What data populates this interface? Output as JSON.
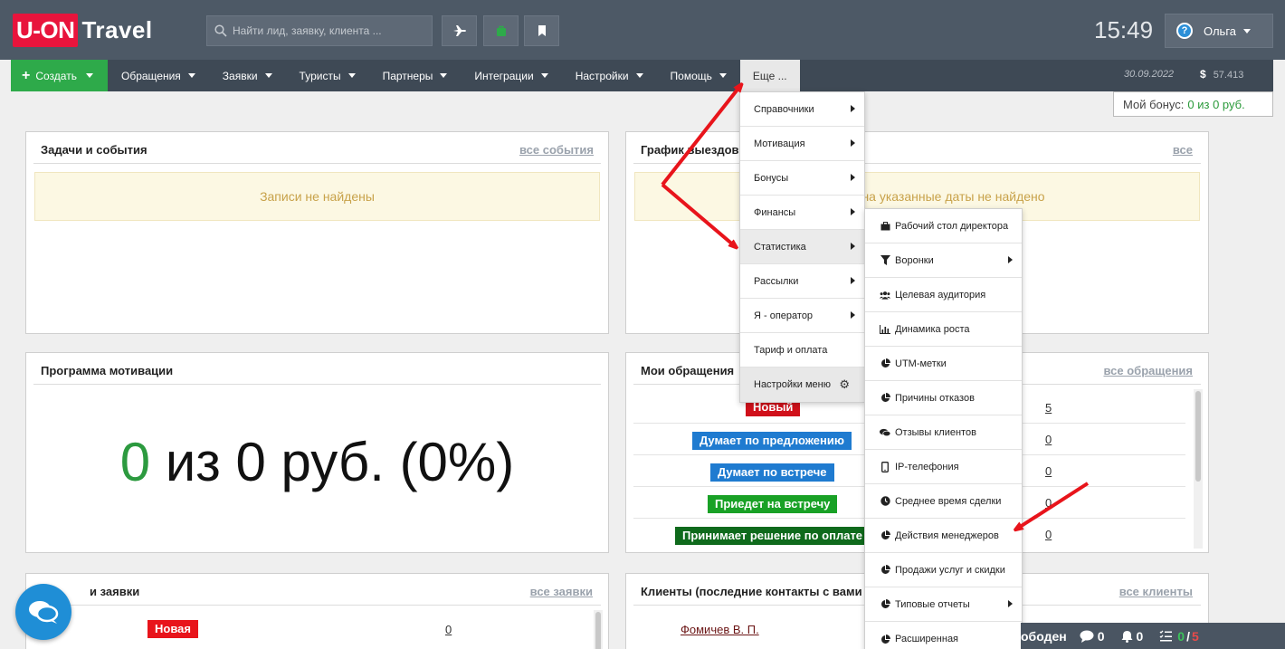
{
  "brand": {
    "logo_box": "U-ON",
    "logo_text": "Travel"
  },
  "search": {
    "placeholder": "Найти лид, заявку, клиента ..."
  },
  "header": {
    "clock": "15:49",
    "user_name": "Ольга"
  },
  "nav": {
    "create": "Создать",
    "items": [
      "Обращения",
      "Заявки",
      "Туристы",
      "Партнеры",
      "Интеграции",
      "Настройки",
      "Помощь"
    ],
    "more": "Еще ...",
    "date": "30.09.2022",
    "currency_symbol": "$",
    "balance": "57.413"
  },
  "bonus": {
    "label": "Мой бонус:",
    "value": "0 из 0 руб."
  },
  "panels": {
    "tasks": {
      "title": "Задачи и события",
      "link": "все события",
      "empty": "Записи не найдены"
    },
    "schedule": {
      "title": "График выездов",
      "link": "все",
      "empty": "на указанные даты не найдено"
    },
    "motivation": {
      "title": "Программа мотивации",
      "stat_zero": "0",
      "stat_rest": " из 0 руб. (0%)"
    },
    "appeals": {
      "title": "Мои обращения",
      "link": "все обращения",
      "rows": [
        {
          "status": "Новый",
          "count": "5",
          "color": "#d0101a"
        },
        {
          "status": "Думает по предложению",
          "count": "0",
          "color": "#1f7bd0"
        },
        {
          "status": "Думает по встрече",
          "count": "0",
          "color": "#1f7bd0"
        },
        {
          "status": "Приедет на встречу",
          "count": "0",
          "color": "#19a126"
        },
        {
          "status": "Принимает решение по оплате",
          "count": "0",
          "color": "#0f6a1c"
        }
      ]
    },
    "requests": {
      "title": "и заявки",
      "link": "все заявки",
      "row_status": "Новая",
      "row_count": "0"
    },
    "clients": {
      "title": "Клиенты (последние контакты с вами",
      "link": "все клиенты",
      "first_client": "Фомичев В. П."
    }
  },
  "menu_more": [
    {
      "label": "Справочники",
      "sub": true
    },
    {
      "label": "Мотивация",
      "sub": true
    },
    {
      "label": "Бонусы",
      "sub": true
    },
    {
      "label": "Финансы",
      "sub": true
    },
    {
      "label": "Статистика",
      "sub": true
    },
    {
      "label": "Рассылки",
      "sub": true
    },
    {
      "label": "Я - оператор",
      "sub": true
    },
    {
      "label": "Тариф и оплата",
      "sub": false
    },
    {
      "label": "Настройки меню",
      "sub": false
    }
  ],
  "menu_stats": [
    {
      "label": "Рабочий стол директора",
      "icon": "briefcase-icon",
      "sub": false
    },
    {
      "label": "Воронки",
      "icon": "funnel-icon",
      "sub": true
    },
    {
      "label": "Целевая аудитория",
      "icon": "users-icon",
      "sub": false
    },
    {
      "label": "Динамика роста",
      "icon": "bar-chart-icon",
      "sub": false
    },
    {
      "label": "UTM-метки",
      "icon": "pie-chart-icon",
      "sub": false
    },
    {
      "label": "Причины отказов",
      "icon": "pie-chart-icon",
      "sub": false
    },
    {
      "label": "Отзывы клиентов",
      "icon": "comments-icon",
      "sub": false
    },
    {
      "label": "IP-телефония",
      "icon": "phone-icon",
      "sub": false
    },
    {
      "label": "Среднее время сделки",
      "icon": "clock-icon",
      "sub": false
    },
    {
      "label": "Действия менеджеров",
      "icon": "pie-chart-icon",
      "sub": false
    },
    {
      "label": "Продажи услуг и скидки",
      "icon": "pie-chart-icon",
      "sub": false
    },
    {
      "label": "Типовые отчеты",
      "icon": "pie-chart-icon",
      "sub": true
    },
    {
      "label": "Расширенная",
      "icon": "pie-chart-icon",
      "sub": false
    }
  ],
  "status_bar": {
    "text": "ободен",
    "messages": "0",
    "notifications": "0",
    "tasks_done": "0",
    "tasks_sep": "/",
    "tasks_total": "5"
  },
  "colors": {
    "topbar": "#4d5966",
    "nav": "#3e4955",
    "create": "#2eaa4a",
    "brand_red": "#e8143c",
    "arrow": "#e8141b"
  }
}
